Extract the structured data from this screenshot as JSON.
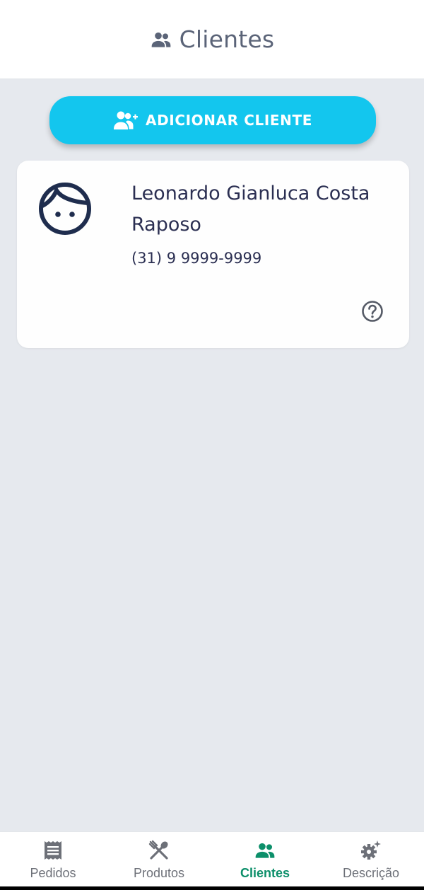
{
  "header": {
    "title": "Clientes",
    "icon": "people-icon"
  },
  "add_button": {
    "label": "ADICIONAR CLIENTE",
    "icon": "person-add-icon"
  },
  "clients": [
    {
      "name": "Leonardo Gianluca Costa Raposo",
      "phone": "(31) 9 9999-9999",
      "avatar": "face-icon",
      "action_icon": "help-circle-icon"
    }
  ],
  "bottom_nav": {
    "items": [
      {
        "label": "Pedidos",
        "icon": "receipt-icon",
        "active": false
      },
      {
        "label": "Produtos",
        "icon": "utensils-icon",
        "active": false
      },
      {
        "label": "Clientes",
        "icon": "people-icon",
        "active": true
      },
      {
        "label": "Descrição",
        "icon": "gear-sparkle-icon",
        "active": false
      }
    ]
  },
  "colors": {
    "background": "#e6e9ee",
    "primary_button": "#13c6ee",
    "active_nav": "#0c8f6a",
    "text_dark": "#2b2f52",
    "header_text": "#5b6478"
  }
}
